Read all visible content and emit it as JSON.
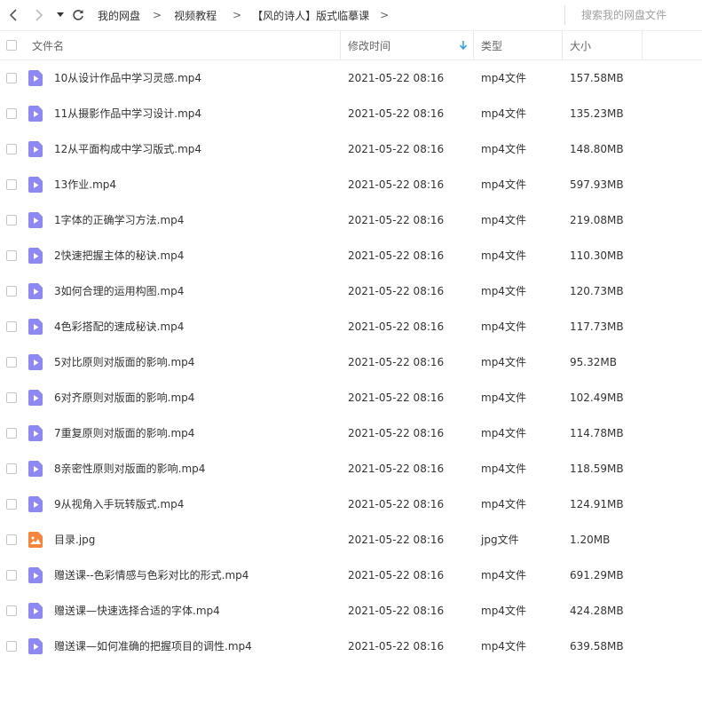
{
  "nav": {
    "back_icon": "chevron-left-icon",
    "forward_icon": "chevron-right-icon",
    "history_icon": "caret-down-icon",
    "refresh_icon": "refresh-icon"
  },
  "breadcrumb": {
    "items": [
      "我的网盘",
      "视频教程",
      "【风的诗人】版式临摹课"
    ],
    "separator": ">"
  },
  "search": {
    "placeholder": "搜索我的网盘文件",
    "value": ""
  },
  "columns": {
    "name": "文件名",
    "modified": "修改时间",
    "type": "类型",
    "size": "大小",
    "sort_icon": "arrow-down-icon",
    "sort_color": "#2b9de9"
  },
  "colors": {
    "video_icon": "#8e88f0",
    "image_icon": "#f5843c"
  },
  "files": [
    {
      "name": "10从设计作品中学习灵感.mp4",
      "date": "2021-05-22 08:16",
      "type": "mp4文件",
      "size": "157.58MB",
      "icon": "video"
    },
    {
      "name": "11从摄影作品中学习设计.mp4",
      "date": "2021-05-22 08:16",
      "type": "mp4文件",
      "size": "135.23MB",
      "icon": "video"
    },
    {
      "name": "12从平面构成中学习版式.mp4",
      "date": "2021-05-22 08:16",
      "type": "mp4文件",
      "size": "148.80MB",
      "icon": "video"
    },
    {
      "name": "13作业.mp4",
      "date": "2021-05-22 08:16",
      "type": "mp4文件",
      "size": "597.93MB",
      "icon": "video"
    },
    {
      "name": "1字体的正确学习方法.mp4",
      "date": "2021-05-22 08:16",
      "type": "mp4文件",
      "size": "219.08MB",
      "icon": "video"
    },
    {
      "name": "2快速把握主体的秘诀.mp4",
      "date": "2021-05-22 08:16",
      "type": "mp4文件",
      "size": "110.30MB",
      "icon": "video"
    },
    {
      "name": "3如何合理的运用构图.mp4",
      "date": "2021-05-22 08:16",
      "type": "mp4文件",
      "size": "120.73MB",
      "icon": "video"
    },
    {
      "name": "4色彩搭配的速成秘诀.mp4",
      "date": "2021-05-22 08:16",
      "type": "mp4文件",
      "size": "117.73MB",
      "icon": "video"
    },
    {
      "name": "5对比原则对版面的影响.mp4",
      "date": "2021-05-22 08:16",
      "type": "mp4文件",
      "size": "95.32MB",
      "icon": "video"
    },
    {
      "name": "6对齐原则对版面的影响.mp4",
      "date": "2021-05-22 08:16",
      "type": "mp4文件",
      "size": "102.49MB",
      "icon": "video"
    },
    {
      "name": "7重复原则对版面的影响.mp4",
      "date": "2021-05-22 08:16",
      "type": "mp4文件",
      "size": "114.78MB",
      "icon": "video"
    },
    {
      "name": "8亲密性原则对版面的影响.mp4",
      "date": "2021-05-22 08:16",
      "type": "mp4文件",
      "size": "118.59MB",
      "icon": "video"
    },
    {
      "name": "9从视角入手玩转版式.mp4",
      "date": "2021-05-22 08:16",
      "type": "mp4文件",
      "size": "124.91MB",
      "icon": "video"
    },
    {
      "name": "目录.jpg",
      "date": "2021-05-22 08:16",
      "type": "jpg文件",
      "size": "1.20MB",
      "icon": "image"
    },
    {
      "name": "赠送课--色彩情感与色彩对比的形式.mp4",
      "date": "2021-05-22 08:16",
      "type": "mp4文件",
      "size": "691.29MB",
      "icon": "video"
    },
    {
      "name": "赠送课—快速选择合适的字体.mp4",
      "date": "2021-05-22 08:16",
      "type": "mp4文件",
      "size": "424.28MB",
      "icon": "video"
    },
    {
      "name": "赠送课—如何准确的把握项目的调性.mp4",
      "date": "2021-05-22 08:16",
      "type": "mp4文件",
      "size": "639.58MB",
      "icon": "video"
    }
  ]
}
